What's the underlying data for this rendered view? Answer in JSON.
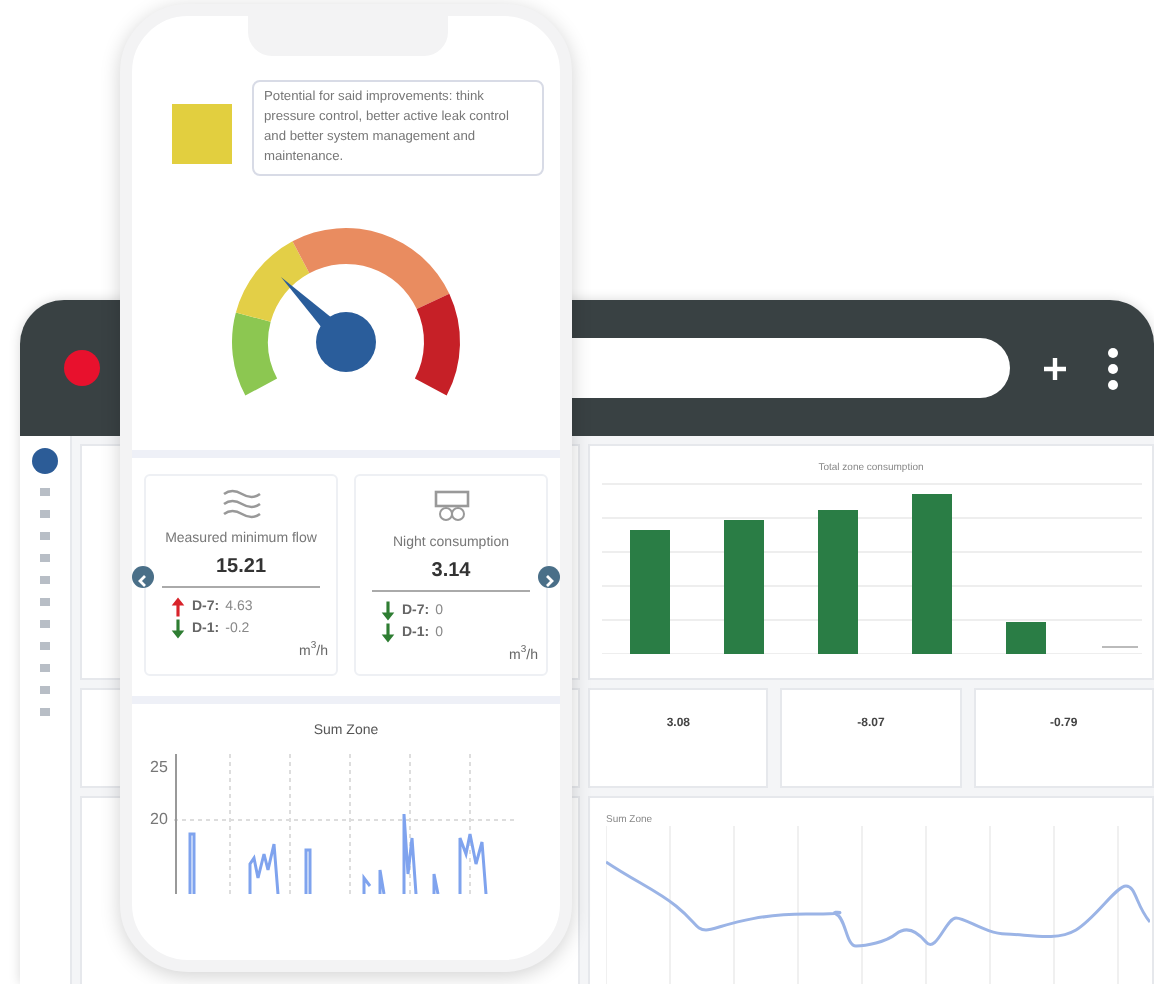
{
  "browser": {
    "bar_chart": {
      "title": "Total zone consumption"
    },
    "kpis": [
      {
        "value": "3.08"
      },
      {
        "value": "-8.07"
      },
      {
        "value": "-0.79"
      }
    ],
    "line_chart": {
      "title": "Sum Zone"
    }
  },
  "phone": {
    "note": {
      "color": "#e2cf3f",
      "text": "Potential for said improvements: think pressure control, better active leak control and better system management and maintenance."
    },
    "kpis": [
      {
        "kind": "waves",
        "title": "Measured minimum flow",
        "value": "15.21",
        "unit": "m$^{3}$/h",
        "rows": [
          {
            "label": "D-7:",
            "value": "4.63",
            "rising": true
          },
          {
            "label": "D-1:",
            "value": "-0.2",
            "rising": false
          }
        ]
      },
      {
        "kind": "meter",
        "title": "Night consumption",
        "value": "3.14",
        "unit": "m$^{3}$/h",
        "rows": [
          {
            "label": "D-7:",
            "value": "0",
            "rising": false
          },
          {
            "label": "D-1:",
            "value": "0",
            "rising": false
          }
        ]
      }
    ],
    "chart": {
      "title": "Sum Zone",
      "yticks": [
        "25",
        "20"
      ]
    }
  }
}
